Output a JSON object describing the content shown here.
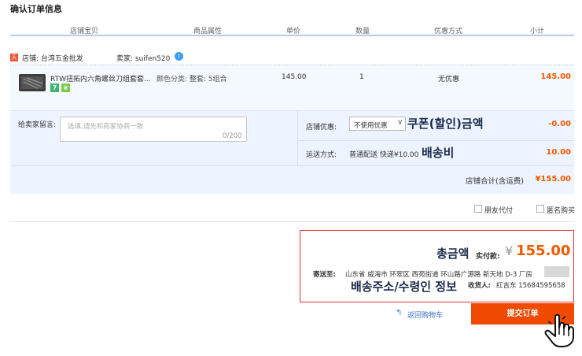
{
  "page_title": "确认订单信息",
  "columns": [
    "店铺宝贝",
    "商品属性",
    "单价",
    "数量",
    "优惠方式",
    "小计"
  ],
  "shop": {
    "badge": "天",
    "label": "店铺: 台湾五金批发",
    "seller": "卖家: suifen520",
    "ww_icon": "i"
  },
  "item": {
    "name": "RTW扭拓内六角螺丝刀组套套...",
    "attr": "颜色分类: 整套: 5组合",
    "price": "145.00",
    "qty": "1",
    "promo": "无优惠",
    "subtotal": "145.00",
    "tag_seven": "7",
    "tag_leaf": "❀"
  },
  "message": {
    "label": "给卖家留言:",
    "placeholder": "选填,请先和商家协商一致",
    "count": "0/200"
  },
  "discount": {
    "label": "店铺优惠:",
    "selected": "不使用优惠",
    "chevron": "∨",
    "annotation": "쿠폰(할인)금액",
    "value": "-0.00"
  },
  "shipping": {
    "label": "运送方式:",
    "value": "普通配送 快递¥10.00",
    "annotation": "배송비",
    "fee": "10.00"
  },
  "shop_total": {
    "label": "店铺合计(含运费)",
    "value": "¥155.00"
  },
  "options": {
    "friend_pay": "朋友代付",
    "anonymous": "匿名购买"
  },
  "payment": {
    "annotation_total": "총금액",
    "paid_label": "实付款:",
    "currency": "¥",
    "total": "155.00",
    "address_label": "寄送至:",
    "address": "山东省 威海市 环翠区 西苑街道 环山路广源路 新天地 D-3 厂房",
    "annotation_addr": "배송주소/수령인 정보",
    "receiver_label": "收货人:",
    "receiver": "红吉东 15684595658"
  },
  "back": {
    "icon": "↰",
    "label": "返回购物车"
  },
  "submit_label": "提交订单",
  "colors": {
    "accent": "#f04a00",
    "price": "#f05a00",
    "highlight_border": "#e8303a",
    "annotation": "#1a2a4a"
  }
}
